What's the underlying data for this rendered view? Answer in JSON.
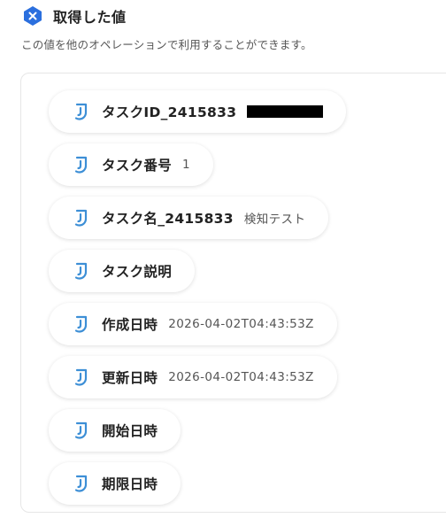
{
  "header": {
    "title": "取得した値",
    "badge_icon": "close-hexagon-icon",
    "badge_color": "#2b6fde"
  },
  "description": "この値を他のオペレーションで利用することができます。",
  "chip_icon_color": "#3d8fd6",
  "fields": [
    {
      "label": "タスクID_2415833",
      "value": "",
      "redacted": true
    },
    {
      "label": "タスク番号",
      "value": "1"
    },
    {
      "label": "タスク名_2415833",
      "value": "検知テスト"
    },
    {
      "label": "タスク説明",
      "value": ""
    },
    {
      "label": "作成日時",
      "value": "2026-04-02T04:43:53Z"
    },
    {
      "label": "更新日時",
      "value": "2026-04-02T04:43:53Z"
    },
    {
      "label": "開始日時",
      "value": ""
    },
    {
      "label": "期限日時",
      "value": ""
    }
  ]
}
